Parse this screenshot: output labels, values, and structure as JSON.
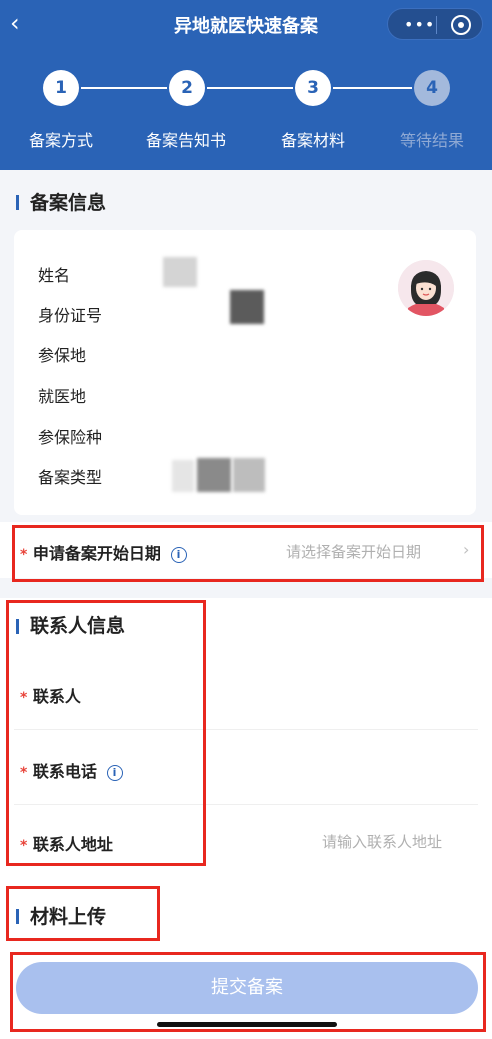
{
  "nav": {
    "back_icon": "chevron-left-icon",
    "title": "异地就医快速备案",
    "more_icon": "more-dots-icon",
    "close_icon": "target-icon"
  },
  "steps": [
    {
      "num": "1",
      "label": "备案方式",
      "active": true
    },
    {
      "num": "2",
      "label": "备案告知书",
      "active": true
    },
    {
      "num": "3",
      "label": "备案材料",
      "active": true
    },
    {
      "num": "4",
      "label": "等待结果",
      "active": false
    }
  ],
  "record_info": {
    "title": "备案信息",
    "fields": [
      {
        "label": "姓名"
      },
      {
        "label": "身份证号"
      },
      {
        "label": "参保地"
      },
      {
        "label": "就医地"
      },
      {
        "label": "参保险种"
      },
      {
        "label": "备案类型"
      }
    ],
    "avatar_icon": "female-avatar-icon"
  },
  "start_date": {
    "required_mark": "*",
    "label": "申请备案开始日期",
    "info_icon": "info-icon",
    "placeholder": "请选择备案开始日期",
    "chevron": "›"
  },
  "contact": {
    "title": "联系人信息",
    "rows": [
      {
        "required_mark": "*",
        "label": "联系人",
        "has_info": false,
        "placeholder": ""
      },
      {
        "required_mark": "*",
        "label": "联系电话",
        "has_info": true,
        "placeholder": ""
      },
      {
        "required_mark": "*",
        "label": "联系人地址",
        "has_info": false,
        "placeholder": "请输入联系人地址"
      }
    ]
  },
  "materials": {
    "title": "材料上传"
  },
  "submit": {
    "label": "提交备案"
  },
  "colors": {
    "brand": "#2a63b6",
    "required": "#e8443a",
    "highlight": "#e8281f",
    "submit_disabled": "#a9c0ee"
  }
}
